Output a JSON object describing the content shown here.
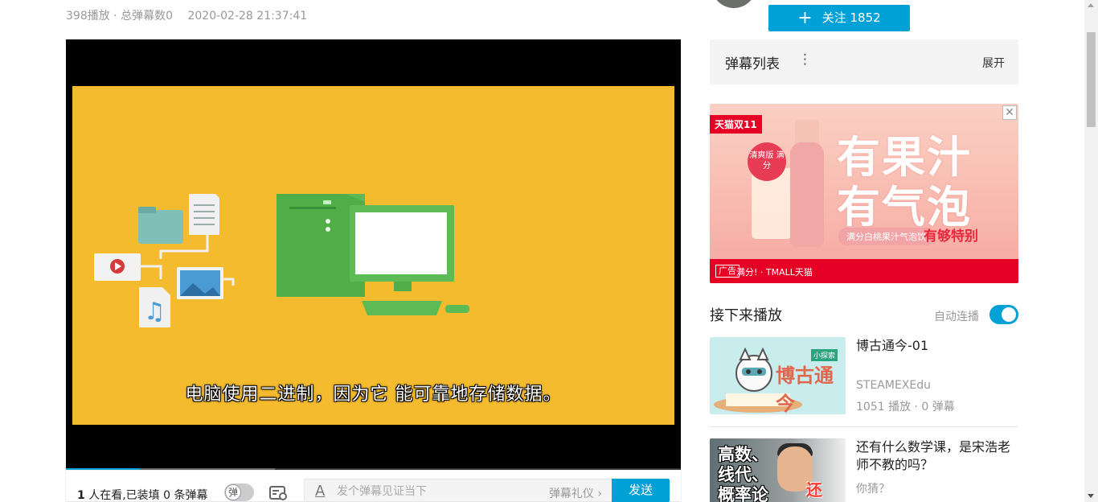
{
  "video_meta": {
    "plays": "398播放",
    "separator": " · ",
    "danmaku_total": "总弹幕数0",
    "date": "2020-02-28 21:37:41"
  },
  "player": {
    "subtitle": "电脑使用二进制，因为它 能可靠地存储数据。",
    "progress_fraction": 0.12
  },
  "sendbar": {
    "viewer_count": "1",
    "viewer_text": " 人在看,已装填 0 条弹幕",
    "toggle_label": "弹",
    "input_placeholder": "发个弹幕见证当下",
    "etiquette_label": "弹幕礼仪",
    "send_label": "发送"
  },
  "uploader": {
    "follow_label": "关注 1852"
  },
  "danmaku_list": {
    "title": "弹幕列表",
    "more_icon": "⋮",
    "expand_label": "展开"
  },
  "ad": {
    "tag": "天猫双11",
    "slogan_line1": "有果汁",
    "slogan_line2": "有气泡",
    "pill": "满分白桃果汁气泡饮",
    "special": "有够特别",
    "ad_label": "广告",
    "brand": "满分! · TMALL天猫",
    "badge": "清爽版 满分",
    "close": "✕"
  },
  "next_up": {
    "heading": "接下来播放",
    "autoplay_label": "自动连播",
    "autoplay_on": true,
    "items": [
      {
        "title": "博古通今-01",
        "author": "STEAMEXEdu",
        "stats": "1051 播放 · 0 弹幕",
        "thumb_text": "博古通今",
        "thumb_logo": "小探索"
      },
      {
        "title": "还有什么数学课，是宋浩老师不教的吗？",
        "author": "你猜？",
        "thumb_lines": [
          "高数、",
          "线代、",
          "概率论"
        ],
        "thumb_badge": "还有?"
      }
    ]
  },
  "colors": {
    "accent": "#00a1d6",
    "video_bg": "#f5bb2e",
    "tmall_red": "#e60026"
  }
}
